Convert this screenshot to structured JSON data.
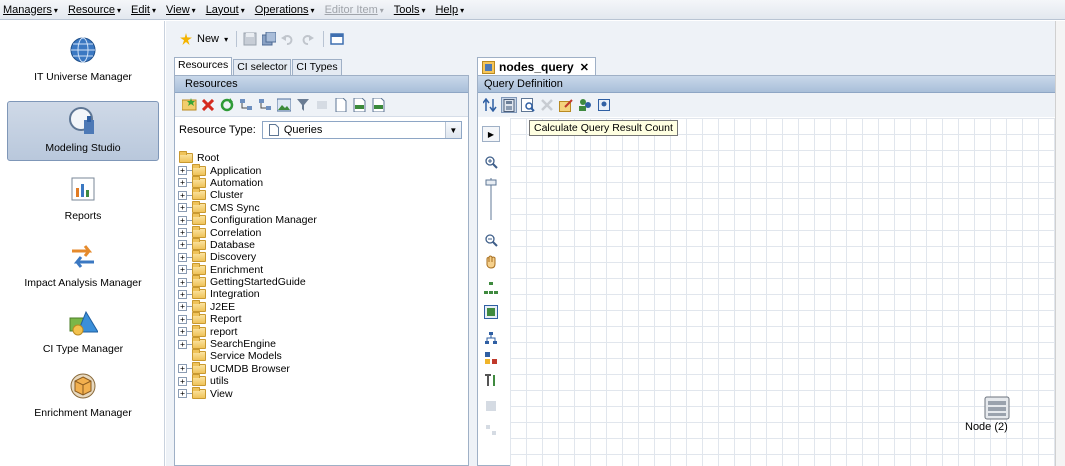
{
  "menubar": {
    "items": [
      {
        "label": "Managers",
        "arrow": "▾",
        "disabled": false
      },
      {
        "label": "Resource",
        "arrow": "▾",
        "disabled": false
      },
      {
        "label": "Edit",
        "arrow": "▾",
        "disabled": false
      },
      {
        "label": "View",
        "arrow": "▾",
        "disabled": false
      },
      {
        "label": "Layout",
        "arrow": "▾",
        "disabled": false
      },
      {
        "label": "Operations",
        "arrow": "▾",
        "disabled": false
      },
      {
        "label": "Editor Item",
        "arrow": "▾",
        "disabled": true
      },
      {
        "label": "Tools",
        "arrow": "▾",
        "disabled": false
      },
      {
        "label": "Help",
        "arrow": "▾",
        "disabled": false
      }
    ]
  },
  "sidebar": {
    "items": [
      {
        "label": "IT Universe Manager",
        "icon": "globe-icon",
        "active": false
      },
      {
        "label": "Modeling Studio",
        "icon": "modeling-studio-icon",
        "active": true
      },
      {
        "label": "Reports",
        "icon": "bar-chart-icon",
        "active": false
      },
      {
        "label": "Impact Analysis Manager",
        "icon": "impact-arrows-icon",
        "active": false
      },
      {
        "label": "CI Type Manager",
        "icon": "ci-shapes-icon",
        "active": false
      },
      {
        "label": "Enrichment Manager",
        "icon": "enrichment-cube-icon",
        "active": false
      }
    ]
  },
  "toolbar": {
    "new_label": "New",
    "new_arrow": "▾"
  },
  "left_panel": {
    "tabs": [
      "Resources",
      "CI selector",
      "CI Types"
    ],
    "active_tab": 0,
    "header": "Resources",
    "resource_type_label": "Resource Type:",
    "resource_type_value": "Queries",
    "tree_root": "Root",
    "tree_items": [
      {
        "label": "Application",
        "expandable": true
      },
      {
        "label": "Automation",
        "expandable": true
      },
      {
        "label": "Cluster",
        "expandable": true
      },
      {
        "label": "CMS Sync",
        "expandable": true
      },
      {
        "label": "Configuration Manager",
        "expandable": true
      },
      {
        "label": "Correlation",
        "expandable": true
      },
      {
        "label": "Database",
        "expandable": true
      },
      {
        "label": "Discovery",
        "expandable": true
      },
      {
        "label": "Enrichment",
        "expandable": true
      },
      {
        "label": "GettingStartedGuide",
        "expandable": true
      },
      {
        "label": "Integration",
        "expandable": true
      },
      {
        "label": "J2EE",
        "expandable": true
      },
      {
        "label": "Report",
        "expandable": true
      },
      {
        "label": "report",
        "expandable": true
      },
      {
        "label": "SearchEngine",
        "expandable": true
      },
      {
        "label": "Service Models",
        "expandable": false
      },
      {
        "label": "UCMDB Browser",
        "expandable": true
      },
      {
        "label": "utils",
        "expandable": true
      },
      {
        "label": "View",
        "expandable": true
      }
    ]
  },
  "right_panel": {
    "doc_tab_title": "nodes_query",
    "doc_tab_close": "✕",
    "header": "Query Definition",
    "tooltip": "Calculate Query Result Count",
    "node_label": "Node (2)"
  },
  "colors": {
    "panel_header": "#b9cde3",
    "active_sidebar": "#c3d1e3",
    "grid_line": "#e1e6ed",
    "folder": "#efc35a"
  }
}
